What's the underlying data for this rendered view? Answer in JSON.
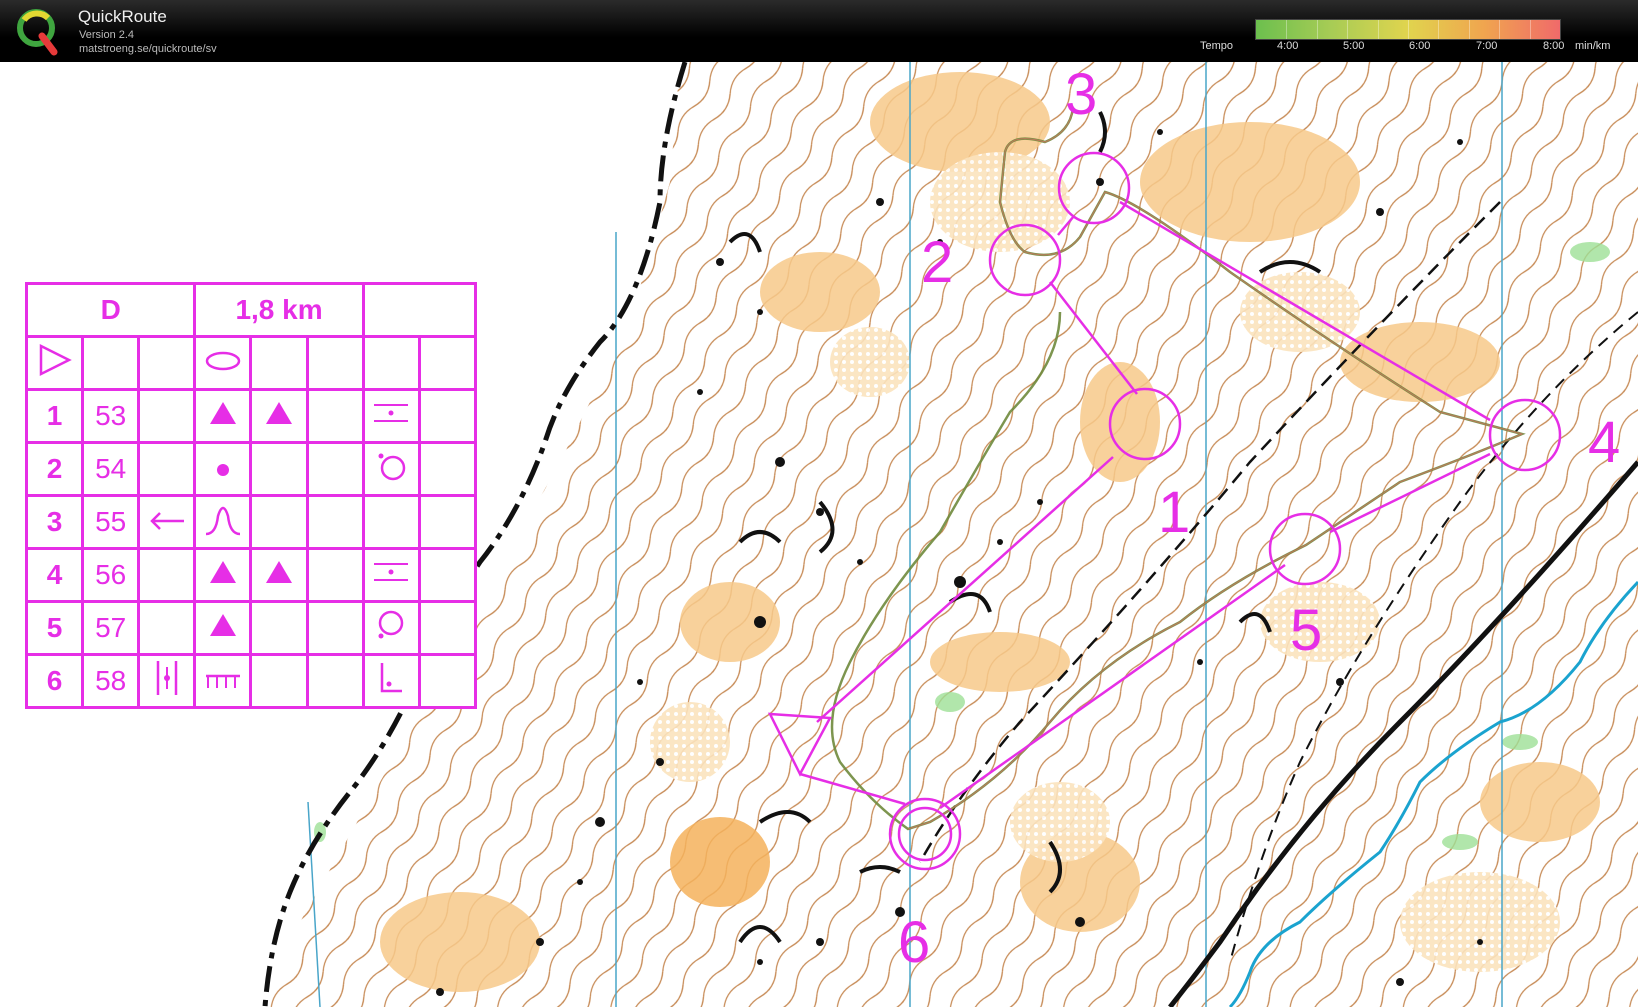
{
  "app": {
    "title": "QuickRoute",
    "version": "Version 2.4",
    "url": "matstroeng.se/quickroute/sv"
  },
  "tempo": {
    "label": "Tempo",
    "ticks": [
      "4:00",
      "5:00",
      "6:00",
      "7:00",
      "8:00"
    ],
    "unit": "min/km"
  },
  "course": {
    "name": "D",
    "length": "1,8 km",
    "controls": [
      {
        "seq": "1",
        "code": "53",
        "symbols": [
          "triangle",
          "triangle",
          "",
          "bar-dot"
        ]
      },
      {
        "seq": "2",
        "code": "54",
        "symbols": [
          "dot",
          "",
          "",
          "circle-dot"
        ]
      },
      {
        "seq": "3",
        "code": "55",
        "symbols": [
          "arrow-left",
          "bell",
          "",
          ""
        ]
      },
      {
        "seq": "4",
        "code": "56",
        "symbols": [
          "triangle",
          "triangle",
          "",
          "bar-dot"
        ]
      },
      {
        "seq": "5",
        "code": "57",
        "symbols": [
          "triangle",
          "",
          "",
          "circle-dot"
        ]
      },
      {
        "seq": "6",
        "code": "58",
        "symbols": [
          "double-bar",
          "comb",
          "",
          "corner"
        ]
      }
    ]
  },
  "map_labels": [
    "1",
    "2",
    "3",
    "4",
    "5",
    "6"
  ],
  "colors": {
    "course": "#e62ee6",
    "route": "#6f8a3c",
    "contour": "#b4641e",
    "open_land": "#f7c98a"
  }
}
